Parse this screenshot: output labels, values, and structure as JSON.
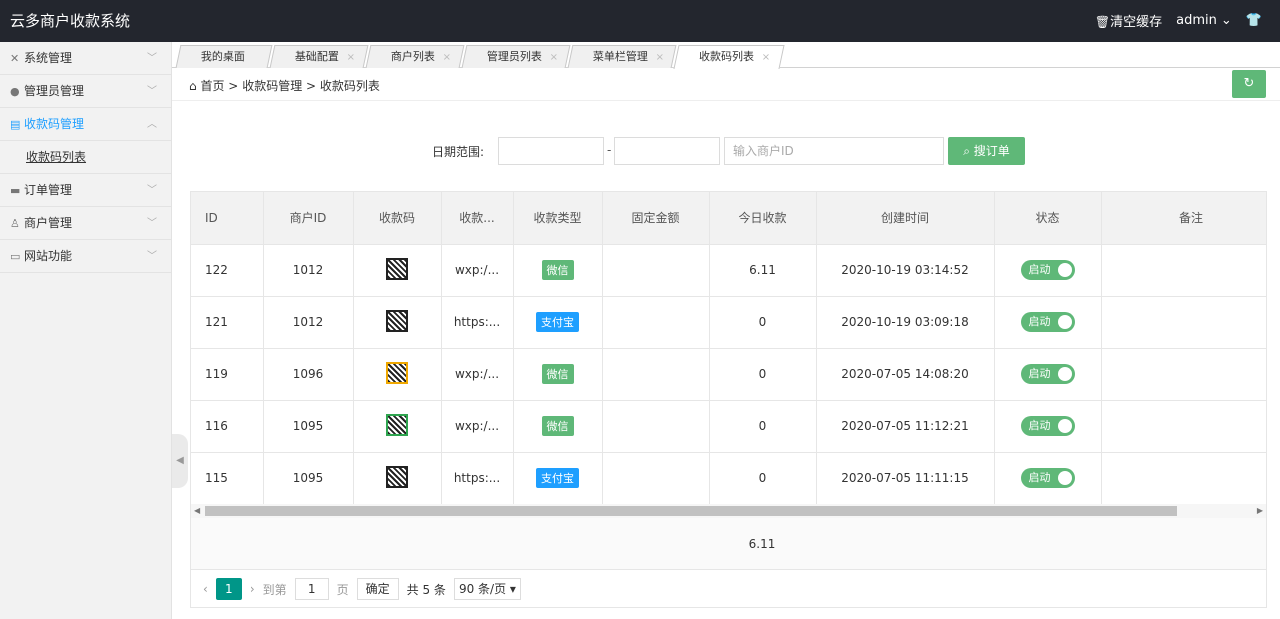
{
  "app": {
    "title": "云多商户收款系统"
  },
  "topbar": {
    "clear_cache": "清空缓存",
    "user": "admin"
  },
  "sidebar": {
    "items": [
      {
        "label": "系统管理",
        "icon": "tools-icon"
      },
      {
        "label": "管理员管理",
        "icon": "user-icon"
      },
      {
        "label": "收款码管理",
        "icon": "list-icon",
        "active": true
      },
      {
        "label": "订单管理",
        "icon": "card-icon"
      },
      {
        "label": "商户管理",
        "icon": "merchant-icon"
      },
      {
        "label": "网站功能",
        "icon": "site-icon"
      }
    ],
    "sub_item": "收款码列表"
  },
  "tabs": [
    "我的桌面",
    "基础配置",
    "商户列表",
    "管理员列表",
    "菜单栏管理",
    "收款码列表"
  ],
  "breadcrumb": {
    "home": "首页",
    "sep": ">",
    "level2": "收款码管理",
    "level3": "收款码列表"
  },
  "search": {
    "date_label": "日期范围:",
    "dash": "-",
    "merchant_placeholder": "输入商户ID",
    "button": "搜订单"
  },
  "table": {
    "headers": [
      "ID",
      "商户ID",
      "收款码",
      "收款...",
      "收款类型",
      "固定金额",
      "今日收款",
      "创建时间",
      "状态",
      "备注"
    ],
    "rows": [
      {
        "id": "122",
        "merchant": "1012",
        "url": "wxp:/...",
        "type": "微信",
        "type_color": "#5fb878",
        "amount": "",
        "today": "6.11",
        "created": "2020-10-19 03:14:52",
        "status": "启动",
        "note": ""
      },
      {
        "id": "121",
        "merchant": "1012",
        "url": "https:...",
        "type": "支付宝",
        "type_color": "#1e9fff",
        "amount": "",
        "today": "0",
        "created": "2020-10-19 03:09:18",
        "status": "启动",
        "note": ""
      },
      {
        "id": "119",
        "merchant": "1096",
        "url": "wxp:/...",
        "type": "微信",
        "type_color": "#5fb878",
        "amount": "",
        "today": "0",
        "created": "2020-07-05 14:08:20",
        "status": "启动",
        "note": ""
      },
      {
        "id": "116",
        "merchant": "1095",
        "url": "wxp:/...",
        "type": "微信",
        "type_color": "#5fb878",
        "amount": "",
        "today": "0",
        "created": "2020-07-05 11:12:21",
        "status": "启动",
        "note": ""
      },
      {
        "id": "115",
        "merchant": "1095",
        "url": "https:...",
        "type": "支付宝",
        "type_color": "#1e9fff",
        "amount": "",
        "today": "0",
        "created": "2020-07-05 11:11:15",
        "status": "启动",
        "note": ""
      }
    ],
    "total_today": "6.11"
  },
  "pager": {
    "current": "1",
    "goto_label": "到第",
    "page_value": "1",
    "page_unit": "页",
    "confirm": "确定",
    "total": "共 5 条",
    "page_size": "90 条/页"
  },
  "colors": {
    "topbar": "#23262e",
    "green": "#5fb878",
    "blue": "#1e9fff",
    "teal": "#009688"
  }
}
